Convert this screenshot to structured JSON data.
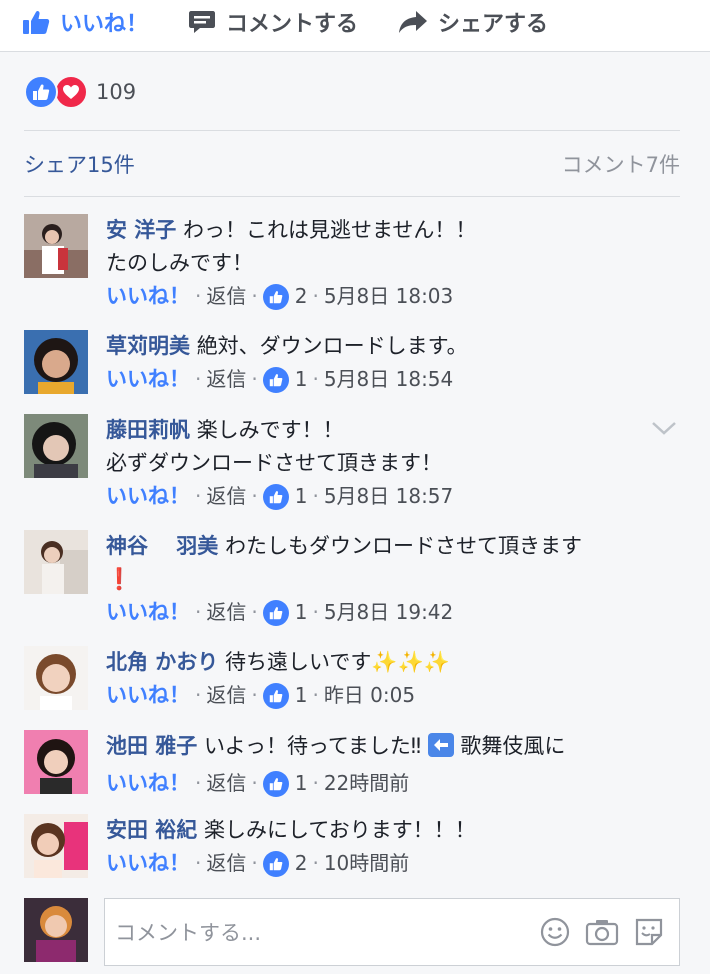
{
  "actions": {
    "like": "いいね！",
    "comment": "コメントする",
    "share": "シェアする"
  },
  "reactions": {
    "count": "109"
  },
  "stats": {
    "shares": "シェア15件",
    "comments": "コメント7件"
  },
  "comments": [
    {
      "author": "安 洋子",
      "text": "わっ！これは見逃せません！！",
      "text2": "たのしみです！",
      "likes": "2",
      "time": "5月8日 18:03"
    },
    {
      "author": "草苅明美",
      "text": "絶対、ダウンロードします。",
      "likes": "1",
      "time": "5月8日 18:54"
    },
    {
      "author": "藤田莉帆",
      "text": "楽しみです！！",
      "text2": "必ずダウンロードさせて頂きます！",
      "likes": "1",
      "time": "5月8日 18:57"
    },
    {
      "author": "神谷　 羽美",
      "text": "わたしもダウンロードさせて頂きます",
      "emoji": "❗",
      "likes": "1",
      "time": "5月8日 19:42"
    },
    {
      "author": "北角 かおり",
      "text": "待ち遠しいです",
      "emoji": "✨✨✨",
      "likes": "1",
      "time": "昨日 0:05"
    },
    {
      "author": "池田 雅子",
      "text": "いよっ！待ってました‼",
      "text_after": "歌舞伎風に",
      "likes": "1",
      "time": "22時間前"
    },
    {
      "author": "安田 裕紀",
      "text": "楽しみにしております！！！",
      "likes": "2",
      "time": "10時間前"
    }
  ],
  "comment_meta": {
    "like": "いいね！",
    "reply": "返信",
    "dot": "·"
  },
  "composer": {
    "placeholder": "コメントする..."
  },
  "colors": {
    "accent": "#4080ff",
    "author": "#365899",
    "love": "#f0284a"
  }
}
